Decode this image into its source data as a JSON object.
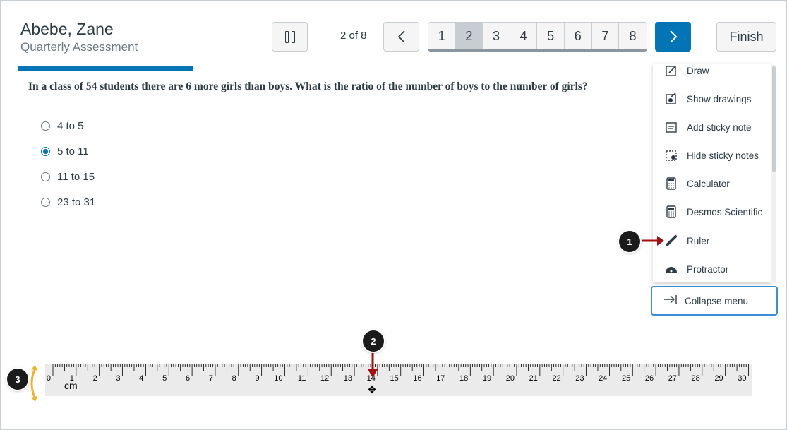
{
  "header": {
    "student_name": "Abebe, Zane",
    "test_name": "Quarterly Assessment",
    "counter": "2 of 8",
    "prev_icon": "chevron-left-icon",
    "next_icon": "chevron-right-icon",
    "pages": [
      "1",
      "2",
      "3",
      "4",
      "5",
      "6",
      "7",
      "8"
    ],
    "current_page": "2",
    "finish_label": "Finish"
  },
  "progress": {
    "fraction": 0.23
  },
  "question": {
    "text": "In a class of 54 students there are 6 more girls than boys. What is the ratio of the number of boys to the number of girls?",
    "options": [
      {
        "label": "4 to 5",
        "checked": false
      },
      {
        "label": "5 to 11",
        "checked": true
      },
      {
        "label": "11 to 15",
        "checked": false
      },
      {
        "label": "23 to 31",
        "checked": false
      }
    ]
  },
  "tools_menu": {
    "items": [
      {
        "label": "Draw",
        "icon": "draw-icon"
      },
      {
        "label": "Show drawings",
        "icon": "show-drawings-icon"
      },
      {
        "label": "Add sticky note",
        "icon": "sticky-note-icon"
      },
      {
        "label": "Hide sticky notes",
        "icon": "hide-sticky-notes-icon"
      },
      {
        "label": "Calculator",
        "icon": "calculator-icon"
      },
      {
        "label": "Desmos Scientific",
        "icon": "desmos-calculator-icon"
      },
      {
        "label": "Ruler",
        "icon": "ruler-icon"
      },
      {
        "label": "Protractor",
        "icon": "protractor-icon"
      }
    ],
    "collapse_label": "Collapse menu"
  },
  "ruler": {
    "unit": "cm",
    "labels": [
      "0",
      "1",
      "2",
      "3",
      "4",
      "5",
      "6",
      "7",
      "8",
      "9",
      "10",
      "11",
      "12",
      "13",
      "14",
      "15",
      "16",
      "17",
      "18",
      "19",
      "20",
      "21",
      "22",
      "23",
      "24",
      "25",
      "26",
      "27",
      "28",
      "29",
      "30"
    ]
  },
  "callouts": [
    "1",
    "2",
    "3"
  ],
  "colors": {
    "accent": "#0374b5",
    "callout_arrow": "#a50f0f",
    "resize_handle": "#f0b429"
  }
}
